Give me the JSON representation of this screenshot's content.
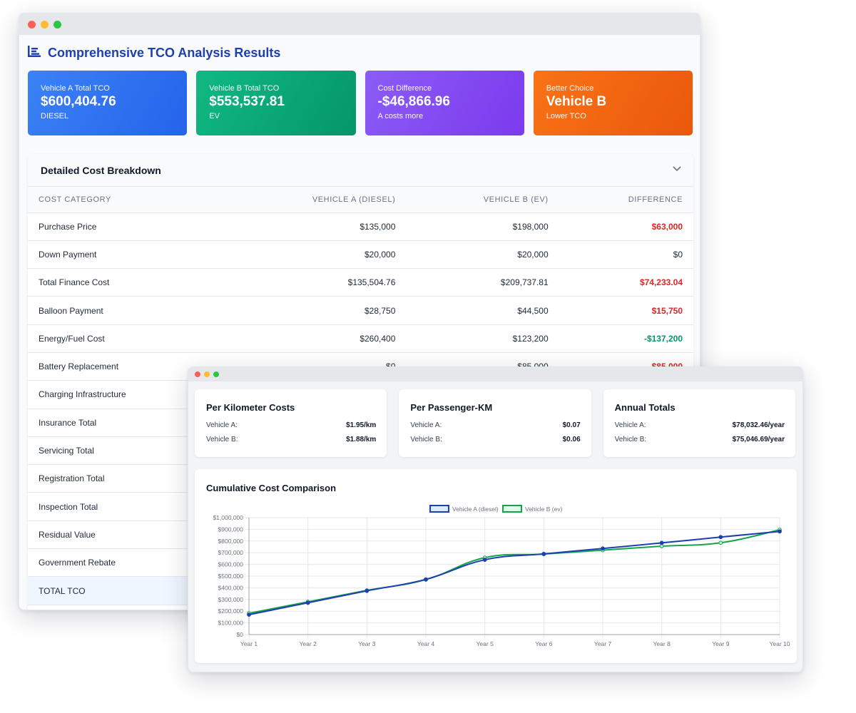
{
  "main_window": {
    "title": "Comprehensive TCO Analysis Results",
    "title_icon": "bar-chart-icon",
    "accent_color": "#1e40af",
    "cards": [
      {
        "label": "Vehicle A Total TCO",
        "value": "$600,404.76",
        "sub": "DIESEL",
        "color": "#2563eb"
      },
      {
        "label": "Vehicle B Total TCO",
        "value": "$553,537.81",
        "sub": "EV",
        "color": "#059669"
      },
      {
        "label": "Cost Difference",
        "value": "-$46,866.96",
        "sub": "A costs more",
        "color": "#7c3aed"
      },
      {
        "label": "Better Choice",
        "value": "Vehicle B",
        "sub": "Lower TCO",
        "color": "#ea580c"
      }
    ],
    "breakdown": {
      "title": "Detailed Cost Breakdown",
      "toggle_icon": "chevron-down-icon",
      "columns": [
        "COST CATEGORY",
        "VEHICLE A (DIESEL)",
        "VEHICLE B (EV)",
        "DIFFERENCE"
      ],
      "rows": [
        {
          "category": "Purchase Price",
          "a": "$135,000",
          "b": "$198,000",
          "diff": "$63,000",
          "diff_type": "pos"
        },
        {
          "category": "Down Payment",
          "a": "$20,000",
          "b": "$20,000",
          "diff": "$0",
          "diff_type": "zero"
        },
        {
          "category": "Total Finance Cost",
          "a": "$135,504.76",
          "b": "$209,737.81",
          "diff": "$74,233.04",
          "diff_type": "pos"
        },
        {
          "category": "Balloon Payment",
          "a": "$28,750",
          "b": "$44,500",
          "diff": "$15,750",
          "diff_type": "pos"
        },
        {
          "category": "Energy/Fuel Cost",
          "a": "$260,400",
          "b": "$123,200",
          "diff": "-$137,200",
          "diff_type": "neg"
        },
        {
          "category": "Battery Replacement",
          "a": "$0",
          "b": "$85,000",
          "diff": "$85,000",
          "diff_type": "pos"
        },
        {
          "category": "Charging Infrastructure",
          "a": "",
          "b": "",
          "diff": "",
          "diff_type": "zero"
        },
        {
          "category": "Insurance Total",
          "a": "",
          "b": "",
          "diff": "",
          "diff_type": "zero"
        },
        {
          "category": "Servicing Total",
          "a": "",
          "b": "",
          "diff": "",
          "diff_type": "zero"
        },
        {
          "category": "Registration Total",
          "a": "",
          "b": "",
          "diff": "",
          "diff_type": "zero"
        },
        {
          "category": "Inspection Total",
          "a": "",
          "b": "",
          "diff": "",
          "diff_type": "zero"
        },
        {
          "category": "Residual Value",
          "a": "",
          "b": "",
          "diff": "",
          "diff_type": "zero"
        },
        {
          "category": "Government Rebate",
          "a": "",
          "b": "",
          "diff": "",
          "diff_type": "zero"
        },
        {
          "category": "TOTAL TCO",
          "a": "",
          "b": "",
          "diff": "",
          "diff_type": "total"
        }
      ]
    }
  },
  "charts_window": {
    "metrics": [
      {
        "title": "Per Kilometer Costs",
        "a_label": "Vehicle A:",
        "a_value": "$1.95/km",
        "b_label": "Vehicle B:",
        "b_value": "$1.88/km"
      },
      {
        "title": "Per Passenger-KM",
        "a_label": "Vehicle A:",
        "a_value": "$0.07",
        "b_label": "Vehicle B:",
        "b_value": "$0.06"
      },
      {
        "title": "Annual Totals",
        "a_label": "Vehicle A:",
        "a_value": "$78,032.46/year",
        "b_label": "Vehicle B:",
        "b_value": "$75,046.69/year"
      }
    ]
  },
  "chart_data": {
    "type": "line",
    "title": "Cumulative Cost Comparison",
    "x": [
      "Year 1",
      "Year 2",
      "Year 3",
      "Year 4",
      "Year 5",
      "Year 6",
      "Year 7",
      "Year 8",
      "Year 9",
      "Year 10"
    ],
    "ylim": [
      0,
      1000000
    ],
    "yticks": [
      "$0",
      "$100,000",
      "$200,000",
      "$300,000",
      "$400,000",
      "$500,000",
      "$600,000",
      "$700,000",
      "$800,000",
      "$900,000",
      "$1,000,000"
    ],
    "grid": true,
    "legend": "top",
    "series": [
      {
        "name": "Vehicle A (diesel)",
        "color": "#1e40af",
        "values": [
          170000,
          272000,
          374000,
          472000,
          640000,
          690000,
          736000,
          784000,
          834000,
          882000
        ]
      },
      {
        "name": "Vehicle B (ev)",
        "color": "#16a34a",
        "values": [
          182000,
          280000,
          378000,
          470000,
          658000,
          688000,
          722000,
          756000,
          785000,
          896000
        ]
      }
    ]
  }
}
